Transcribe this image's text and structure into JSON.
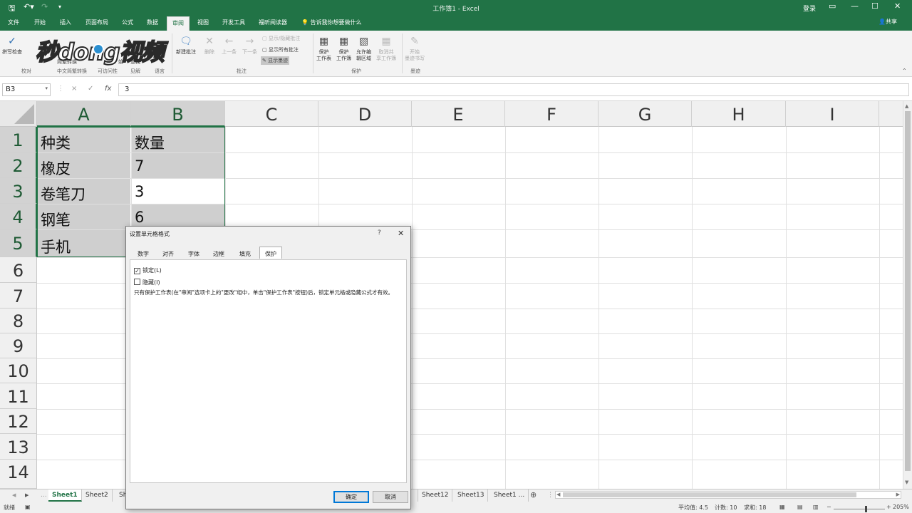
{
  "title_bar": {
    "title": "工作簿1 - Excel",
    "login": "登录",
    "save_icon": "save-icon",
    "undo_icon": "undo-icon",
    "redo_icon": "redo-icon",
    "customize_icon": "customize-qat-icon"
  },
  "ribbon_tabs": [
    "文件",
    "开始",
    "插入",
    "页面布局",
    "公式",
    "数据",
    "审阅",
    "视图",
    "开发工具",
    "福昕阅读器"
  ],
  "active_tab": "审阅",
  "tell_me": "告诉我你想要做什么",
  "share": "共享",
  "watermark": "秒dong视频",
  "ribbon": {
    "spell_check": "拼写检查",
    "simp_trad": "简繁转换",
    "accessibility_frag": "始",
    "lookup": "查找",
    "group_proofing": "校对",
    "group_chinese": "中文简繁转换",
    "group_accessibility": "可访问性",
    "group_insights": "见解",
    "group_language": "语言",
    "new_comment": "新建批注",
    "delete": "删除",
    "previous": "上一条",
    "next": "下一条",
    "show_hide_comment": "显示/隐藏批注",
    "show_all_comments": "显示所有批注",
    "show_ink": "显示墨迹",
    "group_comments": "批注",
    "protect_sheet_1": "保护",
    "protect_sheet_2": "工作表",
    "protect_wb_1": "保护",
    "protect_wb_2": "工作簿",
    "allow_edit_1": "允许编",
    "allow_edit_2": "辑区域",
    "unshare_1": "取消共",
    "unshare_2": "享工作簿",
    "group_protect": "保护",
    "start_ink_1": "开始",
    "start_ink_2": "墨迹书写",
    "group_ink": "墨迹"
  },
  "formula_bar": {
    "name_box": "B3",
    "value": "3",
    "cancel": "×",
    "enter": "✓",
    "fx": "fx"
  },
  "columns": [
    "A",
    "B",
    "C",
    "D",
    "E",
    "F",
    "G",
    "H",
    "I"
  ],
  "rows": [
    "1",
    "2",
    "3",
    "4",
    "5",
    "6",
    "7",
    "8",
    "9",
    "10",
    "11",
    "12",
    "13",
    "14"
  ],
  "cells": {
    "A1": "种类",
    "B1": "数量",
    "A2": "橡皮",
    "B2": "7",
    "A3": "卷笔刀",
    "B3": "3",
    "A4": "钢笔",
    "B4": "6",
    "A5": "手机"
  },
  "sheet_tabs": {
    "left": [
      "Sheet1",
      "Sheet2",
      "Sh"
    ],
    "right": [
      "Sheet12",
      "Sheet13",
      "Sheet1 ..."
    ],
    "active": "Sheet1",
    "add": "⊕"
  },
  "status_bar": {
    "mode": "就绪",
    "average": "平均值: 4.5",
    "count": "计数: 10",
    "sum": "求和: 18",
    "zoom": "205%"
  },
  "dialog": {
    "title": "设置单元格格式",
    "help": "?",
    "close": "✕",
    "tabs": [
      "数字",
      "对齐",
      "字体",
      "边框",
      "填充",
      "保护"
    ],
    "active_tab": "保护",
    "locked_label": "锁定(L)",
    "locked_checked": true,
    "hidden_label": "隐藏(I)",
    "hidden_checked": false,
    "description": "只有保护工作表(在\"审阅\"选项卡上的\"更改\"组中，单击\"保护工作表\"按钮)后，锁定单元格或隐藏公式才有效。",
    "ok": "确定",
    "cancel": "取消"
  }
}
